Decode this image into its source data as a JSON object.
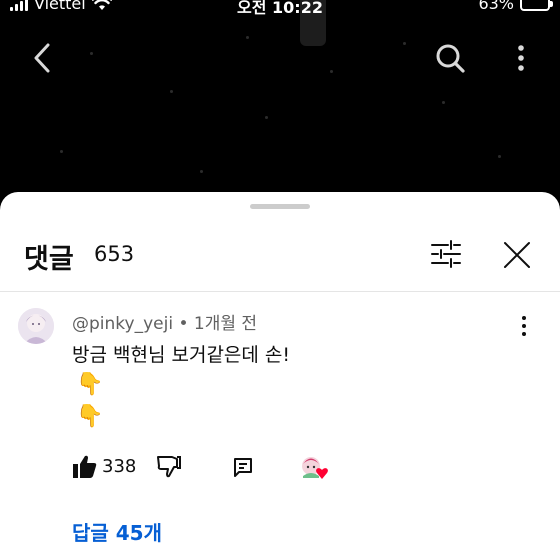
{
  "status_bar": {
    "carrier": "Viettel",
    "time": "오전 10:22",
    "battery": "63%"
  },
  "top_bar": {
    "back_icon": "chevron-left-icon",
    "search_icon": "search-icon",
    "more_icon": "more-vertical-icon"
  },
  "comments_panel": {
    "title": "댓글",
    "count": "653",
    "filter_icon": "sliders-icon",
    "close_icon": "close-icon"
  },
  "comment": {
    "author": "@pinky_yeji",
    "separator": "•",
    "time": "1개월 전",
    "text": "방금 백현님 보거같은데 손!",
    "emoji_1": "👇",
    "emoji_2": "👇",
    "likes": "338",
    "replies_label": "답글 45개"
  },
  "colors": {
    "link": "#065fd4",
    "text": "#0f0f0f",
    "secondary_text": "#606060",
    "heart": "#ff0033"
  }
}
